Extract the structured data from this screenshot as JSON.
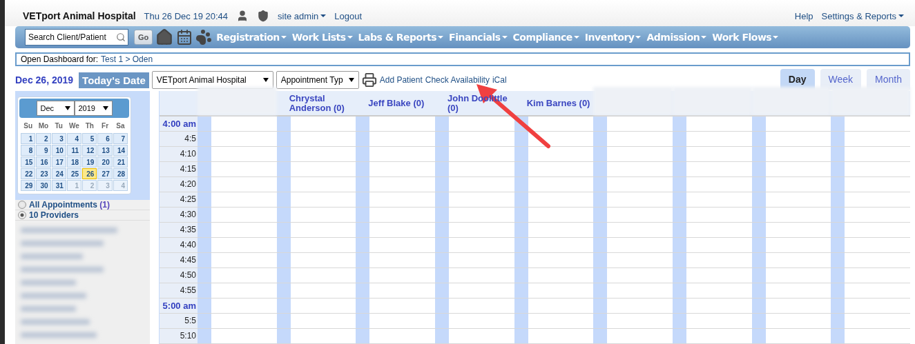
{
  "header": {
    "title": "VETport Animal Hospital",
    "datetime": "Thu 26 Dec 19 20:44",
    "user": "site admin",
    "logout": "Logout",
    "help": "Help",
    "settings": "Settings & Reports"
  },
  "nav": {
    "search_placeholder": "Search Client/Patient",
    "go": "Go",
    "menus": [
      "Registration",
      "Work Lists",
      "Labs & Reports",
      "Financials",
      "Compliance",
      "Inventory",
      "Admission",
      "Work Flows"
    ]
  },
  "dashboard": {
    "label": "Open Dashboard for:",
    "path": "Test 1 > Oden"
  },
  "toolbar": {
    "date": "Dec 26, 2019",
    "today": "Today's Date",
    "location": "VETport Animal Hospital",
    "appointment_type": "Appointment Typ",
    "links": [
      "Add Patient",
      "Check Availability",
      "iCal"
    ]
  },
  "view_tabs": [
    {
      "label": "Day",
      "selected": true
    },
    {
      "label": "Week",
      "selected": false
    },
    {
      "label": "Month",
      "selected": false
    }
  ],
  "calendar": {
    "month": "Dec",
    "year": "2019",
    "weekdays": [
      "Su",
      "Mo",
      "Tu",
      "We",
      "Th",
      "Fr",
      "Sa"
    ],
    "days": [
      {
        "day": "1",
        "other_month": false,
        "selected": false
      },
      {
        "day": "2",
        "other_month": false,
        "selected": false
      },
      {
        "day": "3",
        "other_month": false,
        "selected": false
      },
      {
        "day": "4",
        "other_month": false,
        "selected": false
      },
      {
        "day": "5",
        "other_month": false,
        "selected": false
      },
      {
        "day": "6",
        "other_month": false,
        "selected": false
      },
      {
        "day": "7",
        "other_month": false,
        "selected": false
      },
      {
        "day": "8",
        "other_month": false,
        "selected": false
      },
      {
        "day": "9",
        "other_month": false,
        "selected": false
      },
      {
        "day": "10",
        "other_month": false,
        "selected": false
      },
      {
        "day": "11",
        "other_month": false,
        "selected": false
      },
      {
        "day": "12",
        "other_month": false,
        "selected": false
      },
      {
        "day": "13",
        "other_month": false,
        "selected": false
      },
      {
        "day": "14",
        "other_month": false,
        "selected": false
      },
      {
        "day": "15",
        "other_month": false,
        "selected": false
      },
      {
        "day": "16",
        "other_month": false,
        "selected": false
      },
      {
        "day": "17",
        "other_month": false,
        "selected": false
      },
      {
        "day": "18",
        "other_month": false,
        "selected": false
      },
      {
        "day": "19",
        "other_month": false,
        "selected": false
      },
      {
        "day": "20",
        "other_month": false,
        "selected": false
      },
      {
        "day": "21",
        "other_month": false,
        "selected": false
      },
      {
        "day": "22",
        "other_month": false,
        "selected": false
      },
      {
        "day": "23",
        "other_month": false,
        "selected": false
      },
      {
        "day": "24",
        "other_month": false,
        "selected": false
      },
      {
        "day": "25",
        "other_month": false,
        "selected": false
      },
      {
        "day": "26",
        "other_month": false,
        "selected": true
      },
      {
        "day": "27",
        "other_month": false,
        "selected": false
      },
      {
        "day": "28",
        "other_month": false,
        "selected": false
      },
      {
        "day": "29",
        "other_month": false,
        "selected": false
      },
      {
        "day": "30",
        "other_month": false,
        "selected": false
      },
      {
        "day": "31",
        "other_month": false,
        "selected": false
      },
      {
        "day": "1",
        "other_month": true,
        "selected": false
      },
      {
        "day": "2",
        "other_month": true,
        "selected": false
      },
      {
        "day": "3",
        "other_month": true,
        "selected": false
      },
      {
        "day": "4",
        "other_month": true,
        "selected": false
      }
    ]
  },
  "filters": [
    {
      "label": "All Appointments",
      "count": "(1)",
      "selected": false
    },
    {
      "label": "10 Providers",
      "selected": true
    }
  ],
  "schedule": {
    "columns": [
      {
        "redacted": true
      },
      {
        "name": "Chrystal Anderson (0)",
        "redacted": false
      },
      {
        "name": "Jeff Blake (0)",
        "redacted": false
      },
      {
        "name": "John Doolittle (0)",
        "redacted": false
      },
      {
        "name": "Kim Barnes (0)",
        "redacted": false
      },
      {
        "redacted": true
      },
      {
        "redacted": true
      },
      {
        "redacted": true
      },
      {
        "redacted": true
      }
    ],
    "times": [
      {
        "label": "4:00 am",
        "hour": true
      },
      {
        "label": "4:5",
        "hour": false
      },
      {
        "label": "4:10",
        "hour": false
      },
      {
        "label": "4:15",
        "hour": false
      },
      {
        "label": "4:20",
        "hour": false
      },
      {
        "label": "4:25",
        "hour": false
      },
      {
        "label": "4:30",
        "hour": false
      },
      {
        "label": "4:35",
        "hour": false
      },
      {
        "label": "4:40",
        "hour": false
      },
      {
        "label": "4:45",
        "hour": false
      },
      {
        "label": "4:50",
        "hour": false
      },
      {
        "label": "4:55",
        "hour": false
      },
      {
        "label": "5:00 am",
        "hour": true
      },
      {
        "label": "5:5",
        "hour": false
      },
      {
        "label": "5:10",
        "hour": false
      }
    ]
  }
}
